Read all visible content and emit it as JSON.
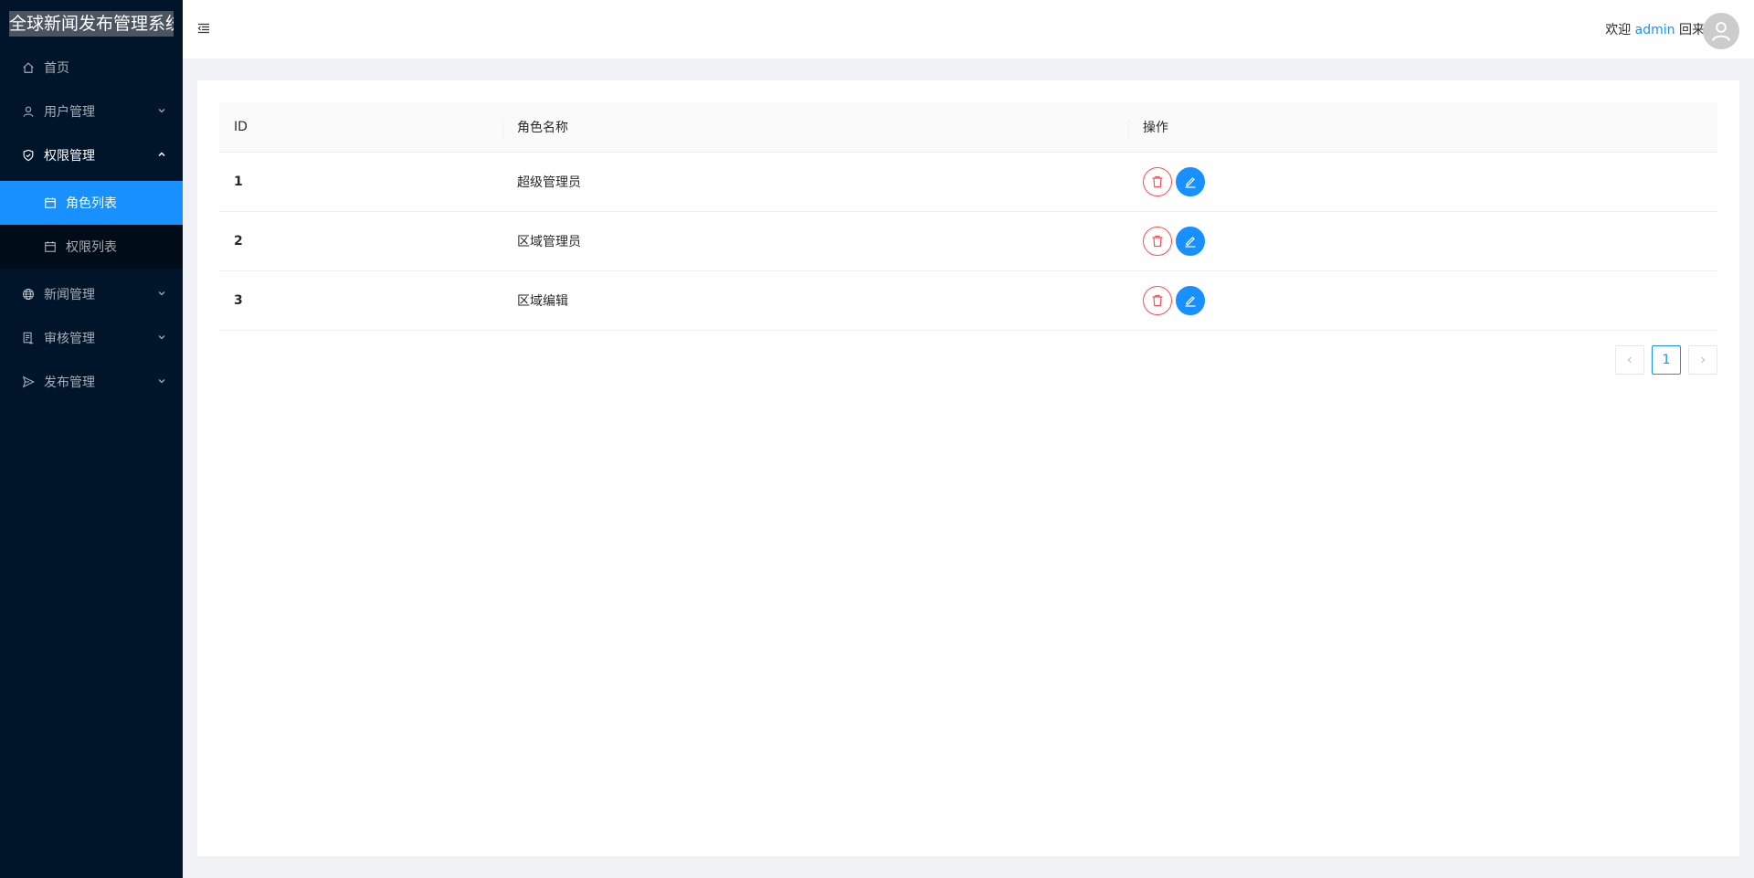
{
  "app": {
    "title": "全球新闻发布管理系统"
  },
  "sidebar": {
    "items": [
      {
        "label": "首页",
        "icon": "home-icon"
      },
      {
        "label": "用户管理",
        "icon": "user-icon"
      },
      {
        "label": "权限管理",
        "icon": "safety-icon"
      },
      {
        "label": "新闻管理",
        "icon": "globe-icon"
      },
      {
        "label": "审核管理",
        "icon": "audit-icon"
      },
      {
        "label": "发布管理",
        "icon": "send-icon"
      }
    ],
    "submenu": [
      {
        "label": "角色列表",
        "icon": "calendar-icon",
        "active": true
      },
      {
        "label": "权限列表",
        "icon": "calendar-icon",
        "active": false
      }
    ]
  },
  "header": {
    "welcome_prefix": "欢迎",
    "username": "admin",
    "welcome_suffix": "回来"
  },
  "table": {
    "columns": [
      "ID",
      "角色名称",
      "操作"
    ],
    "rows": [
      {
        "id": "1",
        "name": "超级管理员"
      },
      {
        "id": "2",
        "name": "区域管理员"
      },
      {
        "id": "3",
        "name": "区域编辑"
      }
    ]
  },
  "pagination": {
    "current": "1"
  },
  "colors": {
    "primary": "#1890ff",
    "danger": "#ff4d4f",
    "sider": "#001529"
  }
}
